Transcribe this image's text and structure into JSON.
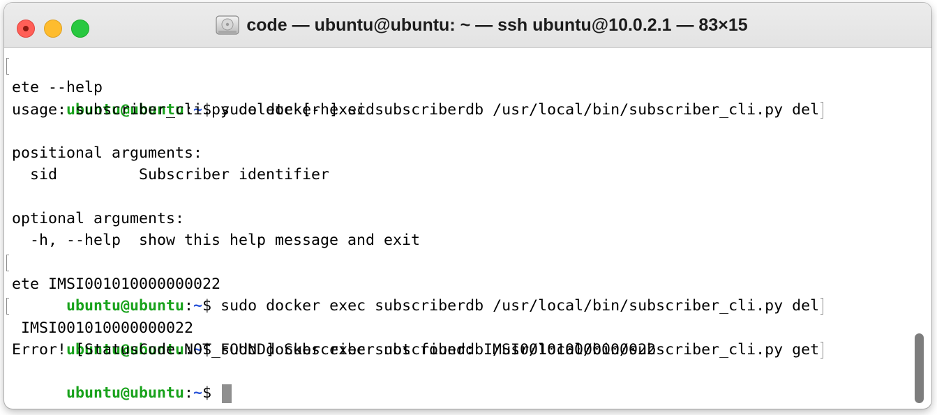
{
  "window": {
    "title": "code — ubuntu@ubuntu: ~ — ssh ubuntu@10.0.2.1 — 83×15",
    "icon": "disk-icon"
  },
  "prompt": {
    "user": "ubuntu@ubuntu",
    "colon": ":",
    "path": "~",
    "symbol": "$"
  },
  "terminal": {
    "line1_cmd": " sudo docker exec subscriberdb /usr/local/bin/subscriber_cli.py del",
    "line2": "ete --help",
    "line3": "usage: subscriber_cli.py delete [-h] sid",
    "line4": "",
    "line5": "positional arguments:",
    "line6": "  sid         Subscriber identifier",
    "line7": "",
    "line8": "optional arguments:",
    "line9": "  -h, --help  show this help message and exit",
    "line10_cmd": " sudo docker exec subscriberdb /usr/local/bin/subscriber_cli.py del",
    "line11": "ete IMSI001010000000022",
    "line12_cmd": " sudo docker exec subscriberdb /usr/local/bin/subscriber_cli.py get",
    "line13": " IMSI001010000000022",
    "line14": "Error! [StatusCode.NOT_FOUND] Subscriber not found: IMSI001010000000022",
    "line15_cmd": " "
  },
  "colors": {
    "user": "#18a21b",
    "path": "#2a54d8",
    "close": "#ff5f57",
    "minimize": "#febc2e",
    "zoom": "#28c840"
  }
}
